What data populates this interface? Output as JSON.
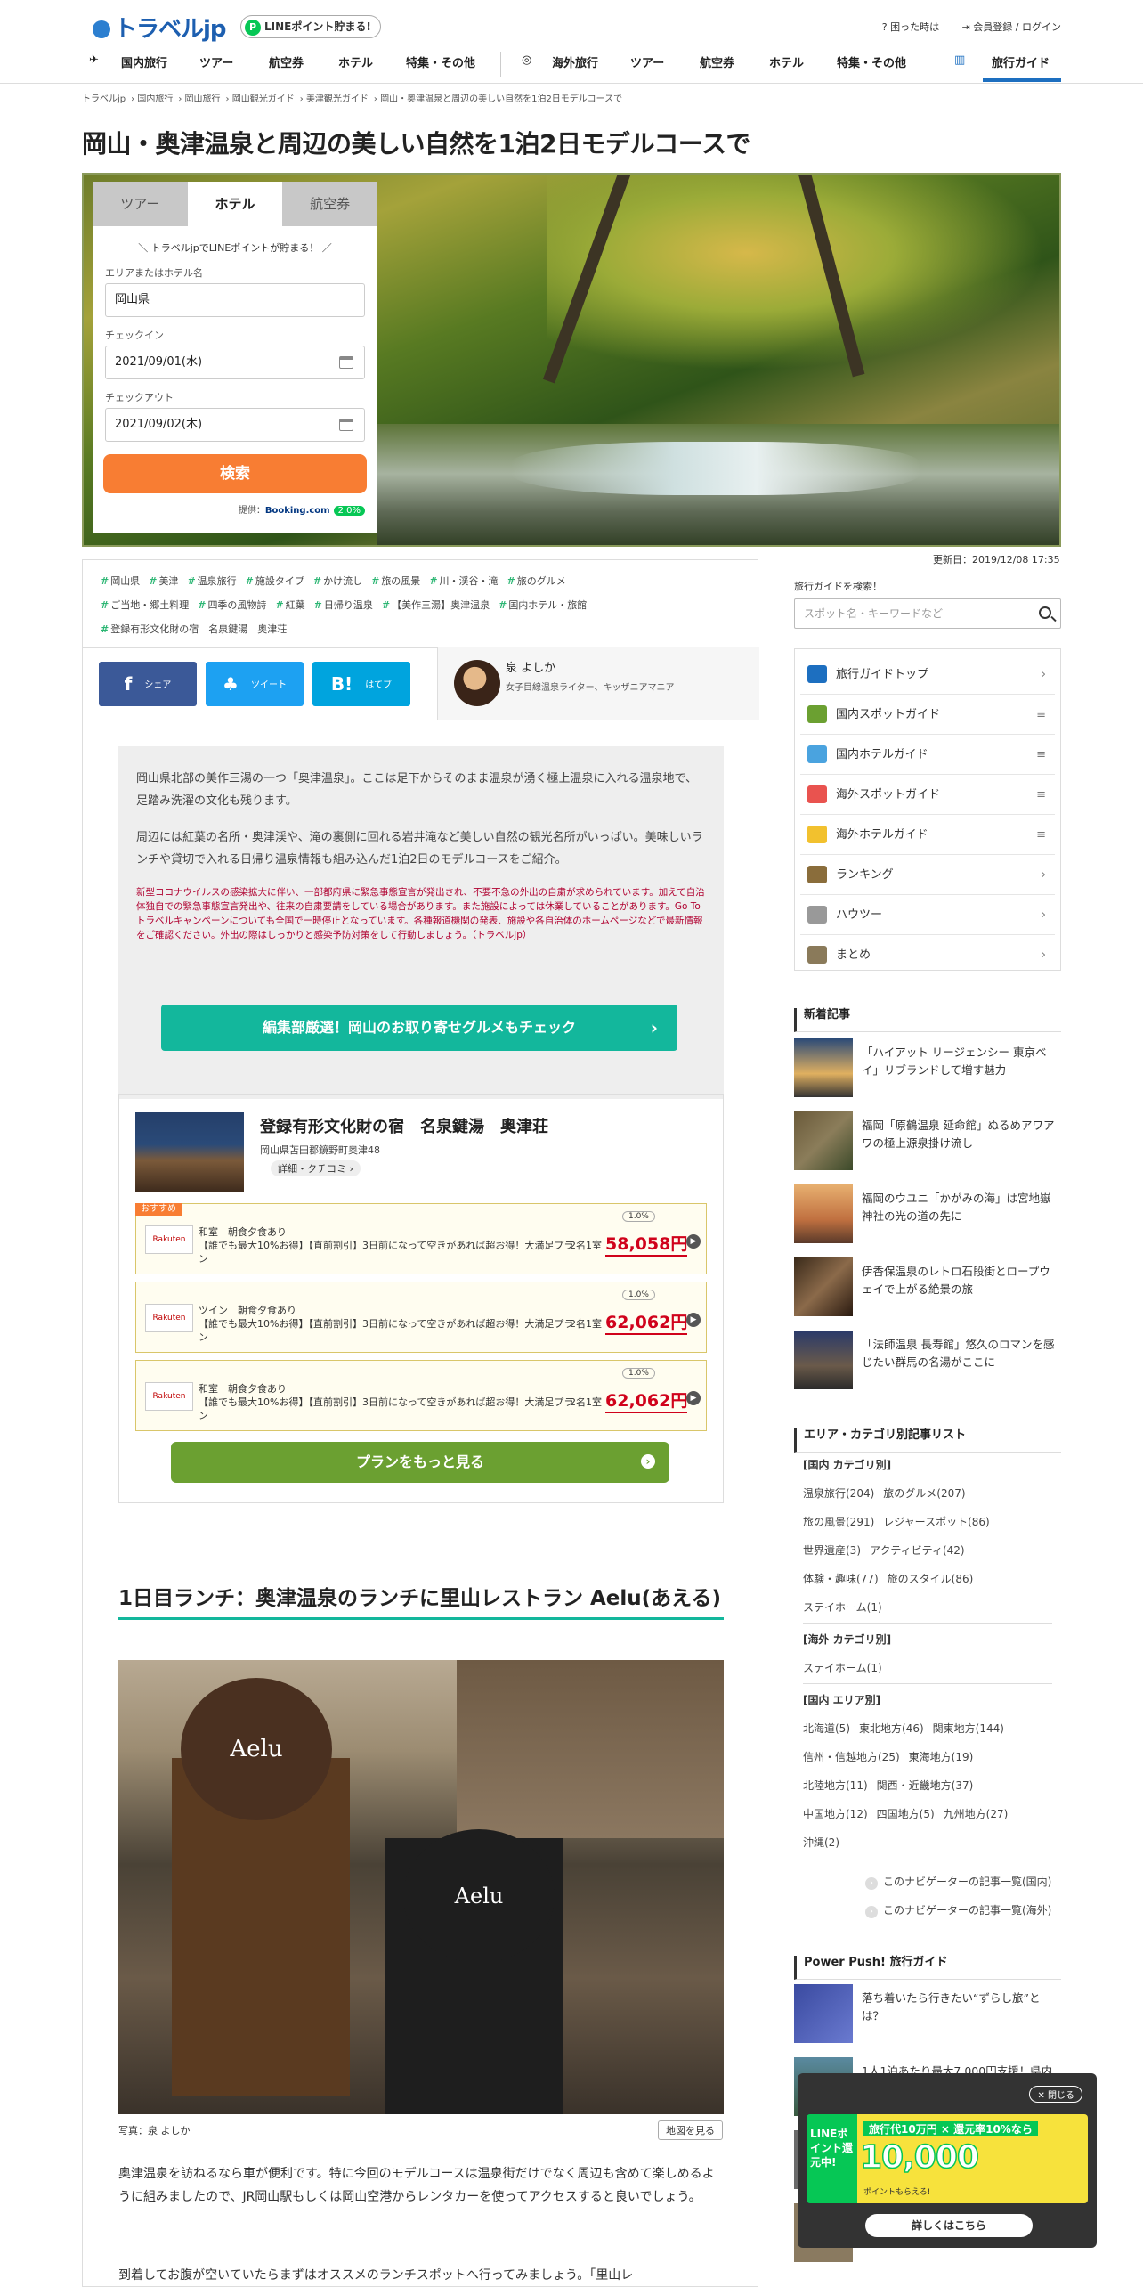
{
  "header": {
    "logo": "トラベルjp",
    "line_badge": "LINEポイント貯まる!",
    "help": "困った時は",
    "login": "会員登録 / ログイン",
    "nav_domestic": [
      "国内旅行",
      "ツアー",
      "航空券",
      "ホテル",
      "特集・その他"
    ],
    "nav_overseas": [
      "海外旅行",
      "ツアー",
      "航空券",
      "ホテル",
      "特集・その他"
    ],
    "nav_guide": "旅行ガイド"
  },
  "breadcrumb": [
    "トラベルjp",
    "国内旅行",
    "岡山旅行",
    "岡山観光ガイド",
    "美津観光ガイド",
    "岡山・奥津温泉と周辺の美しい自然を1泊2日モデルコースで"
  ],
  "page_title": "岡山・奥津温泉と周辺の美しい自然を1泊2日モデルコースで",
  "search_panel": {
    "tabs": [
      "ツアー",
      "ホテル",
      "航空券"
    ],
    "active_tab": "ホテル",
    "message": "＼ トラベルjpでLINEポイントが貯まる！ ／",
    "area_label": "エリアまたはホテル名",
    "area_value": "岡山県",
    "checkin_label": "チェックイン",
    "checkin_value": "2021/09/01(水)",
    "checkout_label": "チェックアウト",
    "checkout_value": "2021/09/02(木)",
    "search_button": "検索",
    "provider_prefix": "提供：",
    "provider": "Booking.com",
    "point": "2.0%"
  },
  "updated": "更新日：2019/12/08 17:35",
  "tags": [
    "岡山県",
    "美津",
    "温泉旅行",
    "施設タイプ",
    "かけ流し",
    "旅の風景",
    "川・渓谷・滝",
    "旅のグルメ",
    "ご当地・郷土料理",
    "四季の風物詩",
    "紅葉",
    "日帰り温泉",
    "【美作三湯】奥津温泉",
    "国内ホテル・旅館",
    "登録有形文化財の宿　名泉鍵湯　奥津荘"
  ],
  "share": {
    "facebook": "シェア",
    "twitter": "ツイート",
    "hatena": "はてブ"
  },
  "author": {
    "name": "泉 よしか",
    "desc": "女子目線温泉ライター、キッザニアマニア"
  },
  "intro": {
    "p1": "岡山県北部の美作三湯の一つ「奥津温泉」。ここは足下からそのまま温泉が湧く極上温泉に入れる温泉地で、足踏み洗濯の文化も残ります。",
    "p2": "周辺には紅葉の名所・奥津渓や、滝の裏側に回れる岩井滝など美しい自然の観光名所がいっぱい。美味しいランチや貸切で入れる日帰り温泉情報も組み込んだ1泊2日のモデルコースをご紹介。",
    "warning": "新型コロナウイルスの感染拡大に伴い、一部都府県に緊急事態宣言が発出され、不要不急の外出の自粛が求められています。加えて自治体独自での緊急事態宣言発出や、往来の自粛要請をしている場合があります。また施設によっては休業していることがあります。Go To トラベルキャンペーンについても全国で一時停止となっています。各種報道機関の発表、施設や各自治体のホームページなどで最新情報をご確認ください。外出の際はしっかりと感染予防対策をして行動しましょう。（トラベルjp）",
    "button": "編集部厳選！岡山のお取り寄せグルメもチェック"
  },
  "hotel": {
    "name": "登録有形文化財の宿　名泉鍵湯　奥津荘",
    "address": "岡山県苫田郡鏡野町奥津48",
    "detail": "詳細・クチコミ ›",
    "recommend": "おすすめ",
    "plans": [
      {
        "logo": "Rakuten",
        "title": "和室　朝食夕食あり",
        "desc": "【誰でも最大10%お得】【直前割引】3日前になって空きがあれば超お得！大満足プラン",
        "room": "2名1室",
        "price": "58,058円",
        "point": "1.0%"
      },
      {
        "logo": "Rakuten",
        "title": "ツイン　朝食夕食あり",
        "desc": "【誰でも最大10%お得】【直前割引】3日前になって空きがあれば超お得！大満足プラン",
        "room": "2名1室",
        "price": "62,062円",
        "point": "1.0%"
      },
      {
        "logo": "Rakuten",
        "title": "和室　朝食夕食あり",
        "desc": "【誰でも最大10%お得】【直前割引】3日前になって空きがあれば超お得！大満足プラン",
        "room": "2名1室",
        "price": "62,062円",
        "point": "1.0%"
      }
    ],
    "more_button": "プランをもっと見る"
  },
  "section": {
    "heading": "1日目ランチ：奥津温泉のランチに里山レストラン Aelu(あえる)",
    "sign1": "Aelu",
    "sign2": "Aelu",
    "caption": "写真：泉 よしか",
    "map_button": "地図を見る",
    "body1": "奥津温泉を訪ねるなら車が便利です。特に今回のモデルコースは温泉街だけでなく周辺も含めて楽しめるように組みましたので、JR岡山駅もしくは岡山空港からレンタカーを使ってアクセスすると良いでしょう。",
    "body2": "到着してお腹が空いていたらまずはオススメのランチスポットへ行ってみましょう。「里山レ"
  },
  "sidebar": {
    "search_title": "旅行ガイドを検索！",
    "search_placeholder": "スポット名・キーワードなど",
    "menu": [
      "旅行ガイドトップ",
      "国内スポットガイド",
      "国内ホテルガイド",
      "海外スポットガイド",
      "海外ホテルガイド",
      "ランキング",
      "ハウツー",
      "まとめ"
    ],
    "new_title": "新着記事",
    "new_articles": [
      "「ハイアット リージェンシー 東京ベイ」リブランドして増す魅力",
      "福岡「原鶴温泉 延命館」ぬるめアワアワの極上源泉掛け流し",
      "福岡のウユニ「かがみの海」は宮地嶽神社の光の道の先に",
      "伊香保温泉のレトロ石段街とロープウェイで上がる絶景の旅",
      "「法師温泉 長寿館」悠久のロマンを感じたい群馬の名湯がここに"
    ],
    "category_title": "エリア・カテゴリ別記事リスト",
    "dom_cat_title": "[国内 カテゴリ別]",
    "dom_cat": [
      [
        "温泉旅行(204)",
        "旅のグルメ(207)"
      ],
      [
        "旅の風景(291)",
        "レジャースポット(86)"
      ],
      [
        "世界遺産(3)",
        "アクティビティ(42)"
      ],
      [
        "体験・趣味(77)",
        "旅のスタイル(86)"
      ],
      [
        "ステイホーム(1)"
      ]
    ],
    "ovs_cat_title": "[海外 カテゴリ別]",
    "ovs_cat": [
      "ステイホーム(1)"
    ],
    "dom_area_title": "[国内 エリア別]",
    "dom_area": [
      [
        "北海道(5)",
        "東北地方(46)",
        "関東地方(144)"
      ],
      [
        "信州・信越地方(25)",
        "東海地方(19)"
      ],
      [
        "北陸地方(11)",
        "関西・近畿地方(37)"
      ],
      [
        "中国地方(12)",
        "四国地方(5)",
        "九州地方(27)"
      ],
      [
        "沖縄(2)"
      ]
    ],
    "nav_link_dom": "このナビゲーターの記事一覧(国内)",
    "nav_link_ovs": "このナビゲーターの記事一覧(海外)",
    "push_title": "Power Push! 旅行ガイド",
    "push_articles": [
      "落ち着いたら行きたい“ずらし旅”とは？",
      "1人1泊あたり最大7,000円支援！県内旅行をお得に楽しもう"
    ]
  },
  "ad": {
    "close": "閉じる",
    "line_text": "LINEポイント還元中!",
    "promo": "旅行代10万円 × 還元率10%なら",
    "amount": "10,000",
    "fine": "ポイントもらえる!",
    "go": "詳しくはこちら"
  }
}
